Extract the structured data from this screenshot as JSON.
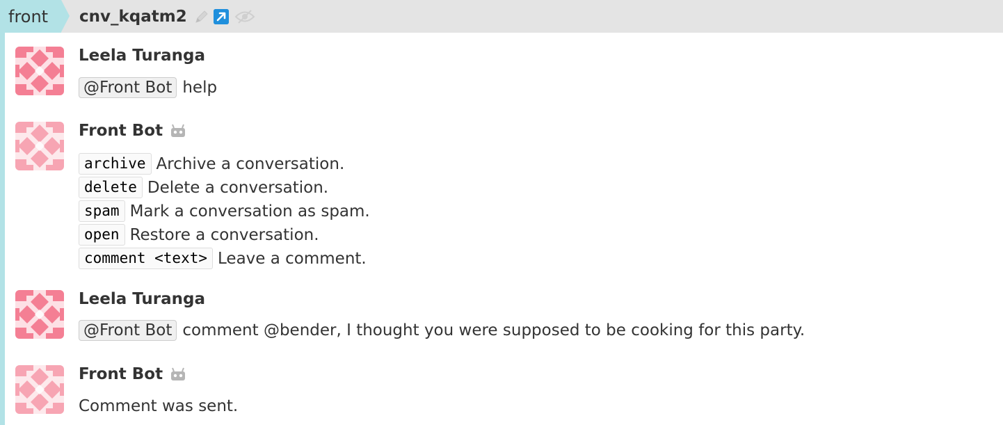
{
  "header": {
    "stream": "front",
    "topic": "cnv_kqatm2",
    "icons": [
      "pencil-icon",
      "external-link-icon",
      "eye-slash-icon"
    ],
    "stream_color": "#b2e2e6"
  },
  "messages": [
    {
      "sender": "Leela Turanga",
      "mention": "@Front Bot",
      "text": "help"
    },
    {
      "sender": "Front Bot",
      "commands": [
        {
          "code": "archive",
          "desc": "Archive a conversation."
        },
        {
          "code": "delete",
          "desc": "Delete a conversation."
        },
        {
          "code": "spam",
          "desc": "Mark a conversation as spam."
        },
        {
          "code": "open",
          "desc": "Restore a conversation."
        },
        {
          "code": "comment <text>",
          "desc": "Leave a comment."
        }
      ]
    },
    {
      "sender": "Leela Turanga",
      "mention": "@Front Bot",
      "text": "comment @bender, I thought you were supposed to be cooking for this party."
    },
    {
      "sender": "Front Bot",
      "text": "Comment was sent."
    }
  ]
}
